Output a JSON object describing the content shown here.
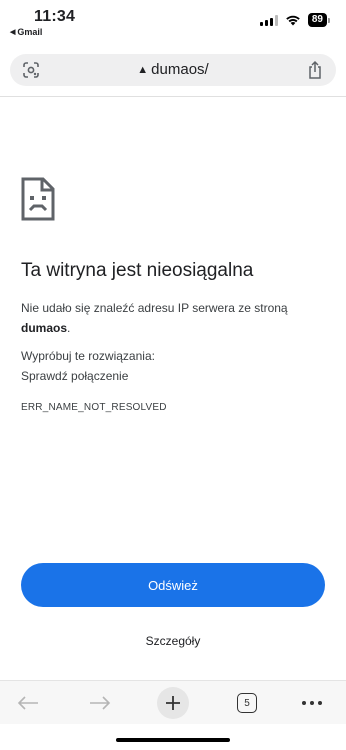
{
  "status_bar": {
    "time": "11:34",
    "back_app": "Gmail",
    "battery": "89"
  },
  "address_bar": {
    "url": "dumaos/",
    "icons": [
      "google-lens-icon",
      "not-secure-warning-icon",
      "share-icon"
    ]
  },
  "error": {
    "icon": "sad-document-icon",
    "title": "Ta witryna jest nieosiągalna",
    "line1": "Nie udało się znaleźć adresu IP serwera ze stroną",
    "host": "dumaos",
    "host_suffix": ".",
    "try_label": "Wypróbuj te rozwiązania:",
    "suggestion": "Sprawdź połączenie",
    "code": "ERR_NAME_NOT_RESOLVED"
  },
  "buttons": {
    "reload": "Odśwież",
    "details": "Szczegóły"
  },
  "toolbar": {
    "tab_count": "5",
    "icons": [
      "back-arrow-icon",
      "forward-arrow-icon",
      "new-tab-plus-icon",
      "tab-switcher-icon",
      "more-menu-icon"
    ]
  },
  "colors": {
    "accent": "#1a73e8",
    "text": "#202124",
    "address_bg": "#efeff0"
  }
}
